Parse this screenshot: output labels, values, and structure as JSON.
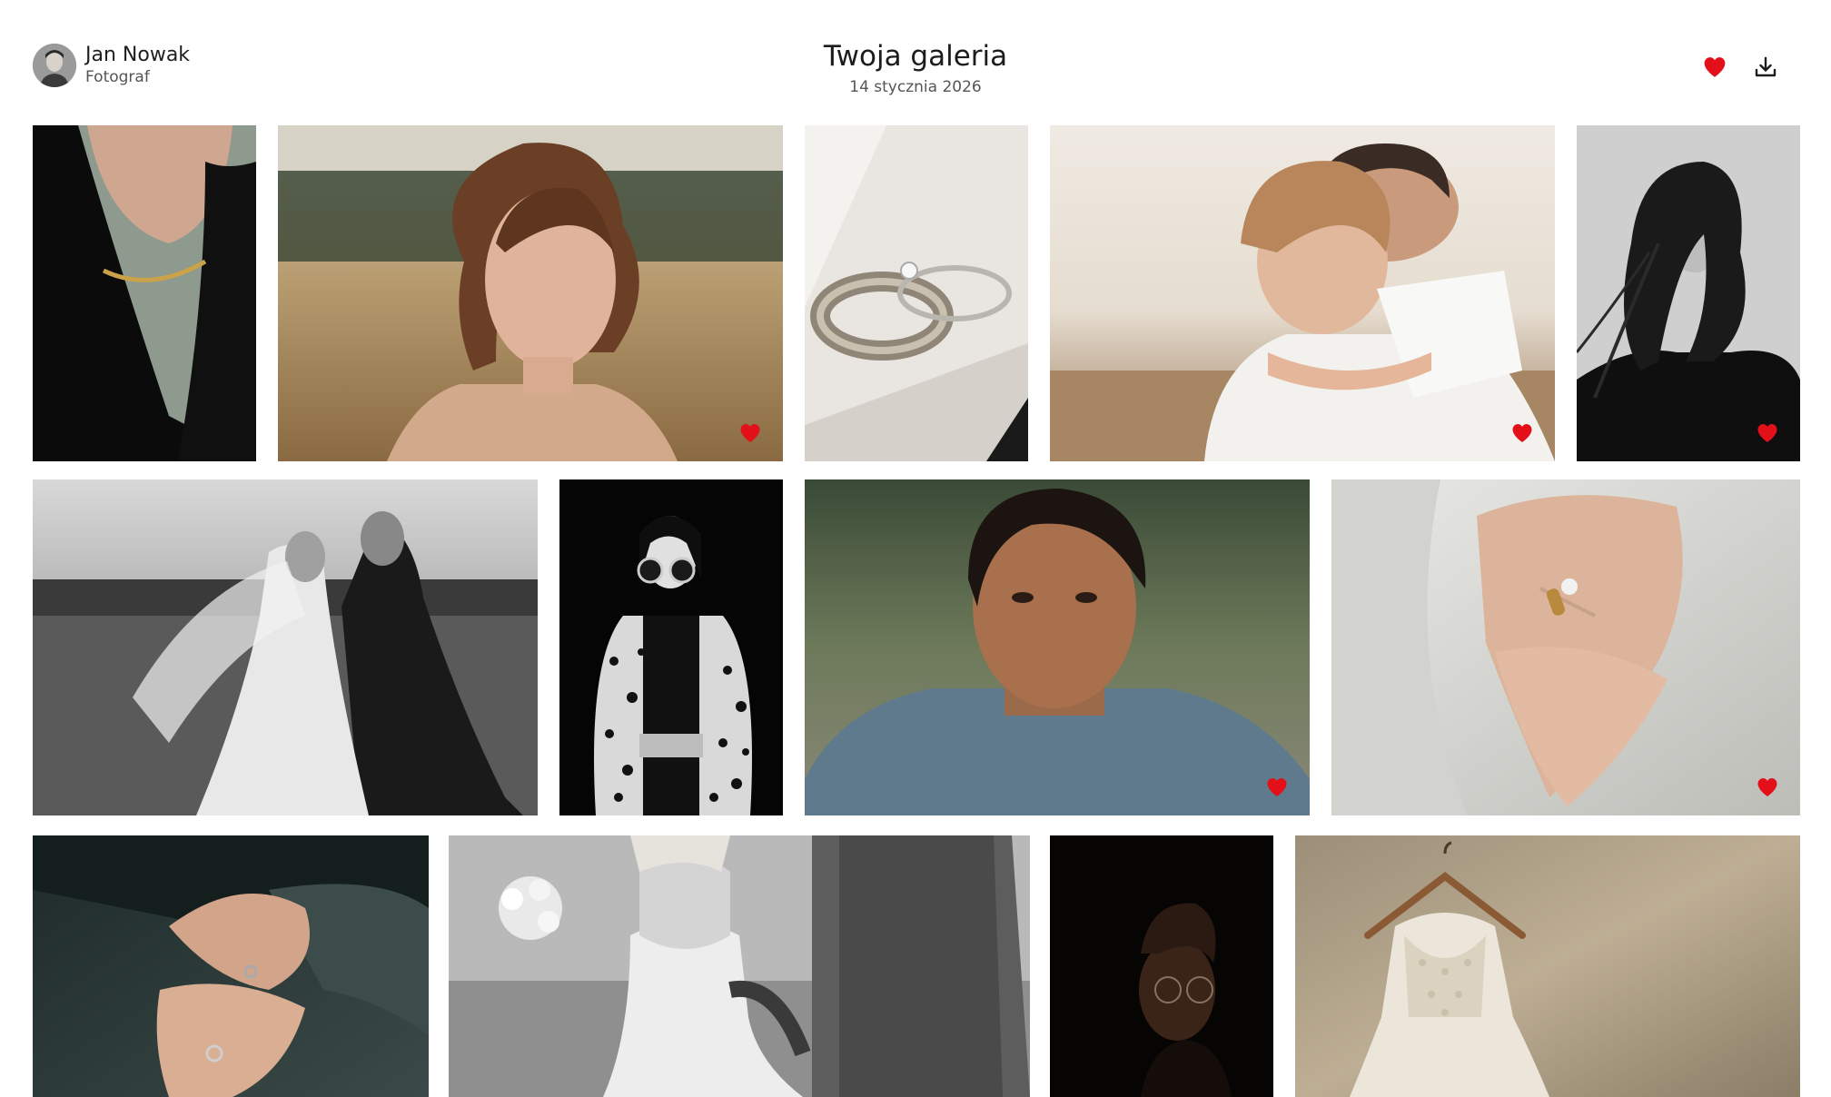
{
  "header": {
    "photographer_name": "Jan Nowak",
    "photographer_role": "Fotograf",
    "title": "Twoja galeria",
    "date": "14 stycznia 2026"
  },
  "icons": {
    "favorites": "heart-icon",
    "download": "download-icon",
    "photo_favorite": "heart-icon"
  },
  "colors": {
    "favorite": "#e3101a",
    "text_primary": "#1c1c1c",
    "text_secondary": "#555555"
  },
  "gallery": {
    "rows": [
      [
        {
          "subject": "necklace",
          "favorite": false
        },
        {
          "subject": "woman-portrait-field",
          "favorite": true
        },
        {
          "subject": "wedding-rings",
          "favorite": false
        },
        {
          "subject": "father-and-child",
          "favorite": true
        },
        {
          "subject": "woman-windblown-hair",
          "favorite": true
        }
      ],
      [
        {
          "subject": "couple-kiss-veil",
          "favorite": false
        },
        {
          "subject": "woman-sunglasses-leopard-coat",
          "favorite": false
        },
        {
          "subject": "man-portrait",
          "favorite": true
        },
        {
          "subject": "hands-with-ring",
          "favorite": true
        }
      ],
      [
        {
          "subject": "holding-hands",
          "favorite": false
        },
        {
          "subject": "couple-walking",
          "favorite": false
        },
        {
          "subject": "man-glasses-dark",
          "favorite": false
        },
        {
          "subject": "wedding-dress-hanger",
          "favorite": false
        }
      ]
    ]
  }
}
